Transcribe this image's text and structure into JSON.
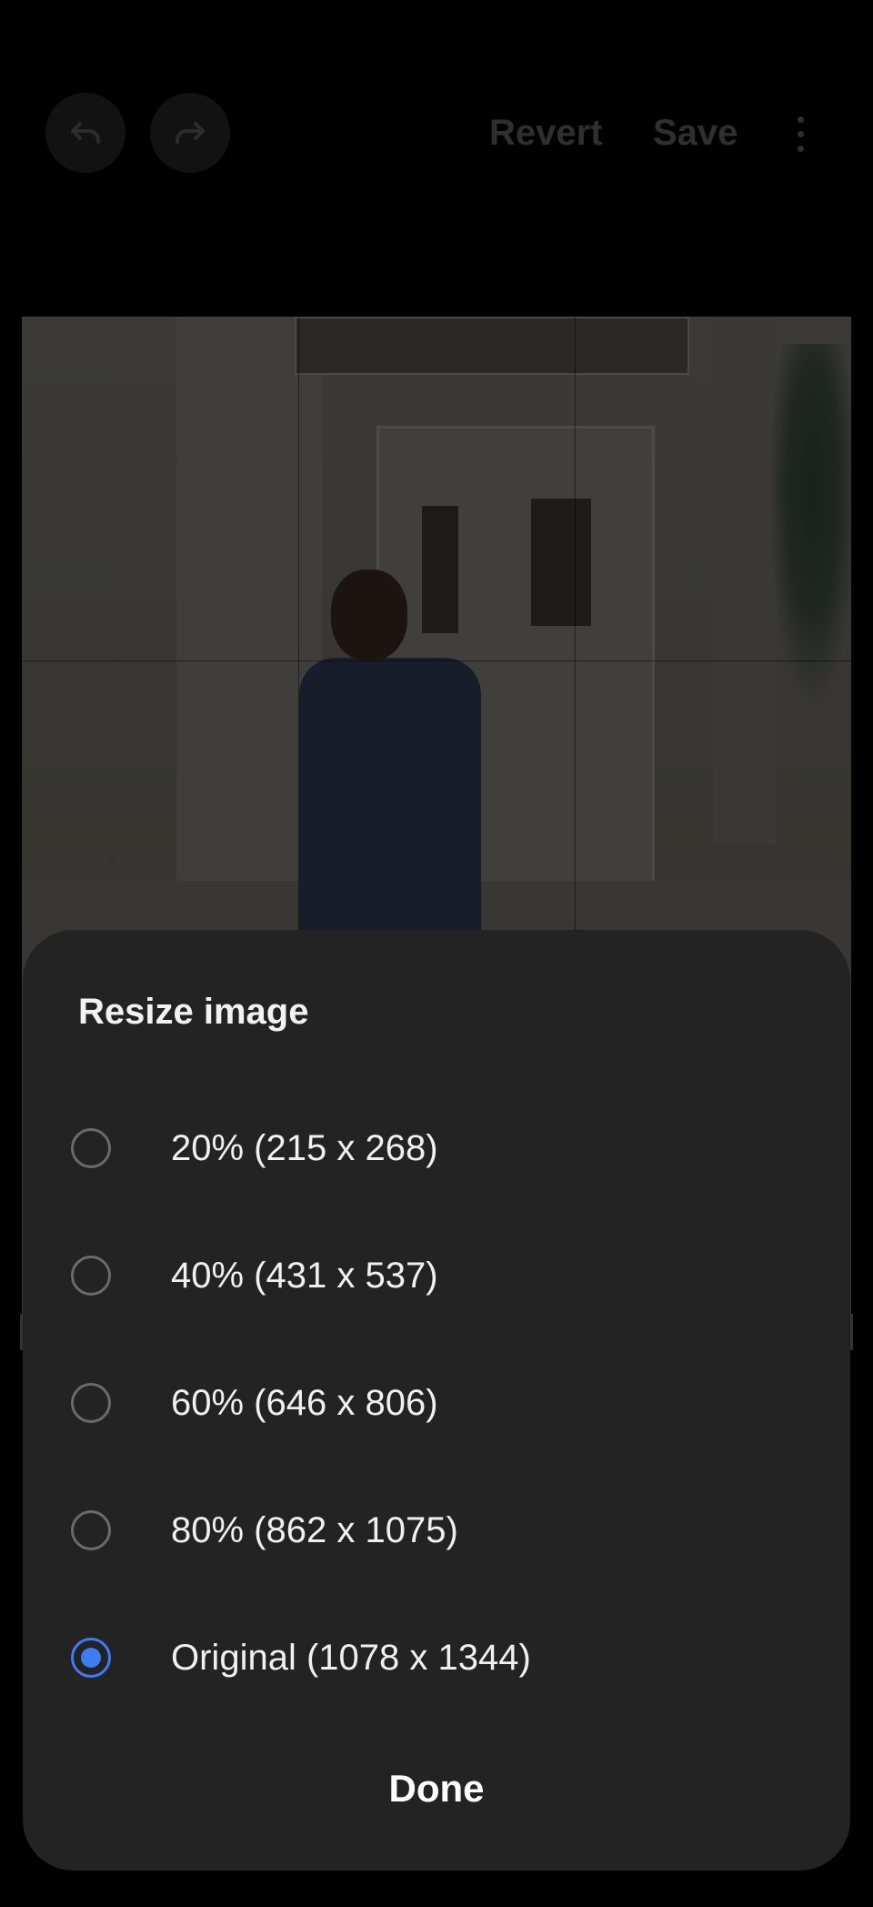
{
  "toolbar": {
    "undo_icon": "undo-icon",
    "redo_icon": "redo-icon",
    "revert_label": "Revert",
    "save_label": "Save",
    "more_icon": "more-vertical-icon"
  },
  "dialog": {
    "title": "Resize image",
    "options": [
      {
        "label": "20% (215 x 268)",
        "selected": false
      },
      {
        "label": "40% (431 x 537)",
        "selected": false
      },
      {
        "label": "60% (646 x 806)",
        "selected": false
      },
      {
        "label": "80% (862 x 1075)",
        "selected": false
      },
      {
        "label": "Original (1078 x 1344)",
        "selected": true
      }
    ],
    "done_label": "Done"
  },
  "colors": {
    "accent": "#3d7cf5",
    "sheet_background": "#232323"
  }
}
